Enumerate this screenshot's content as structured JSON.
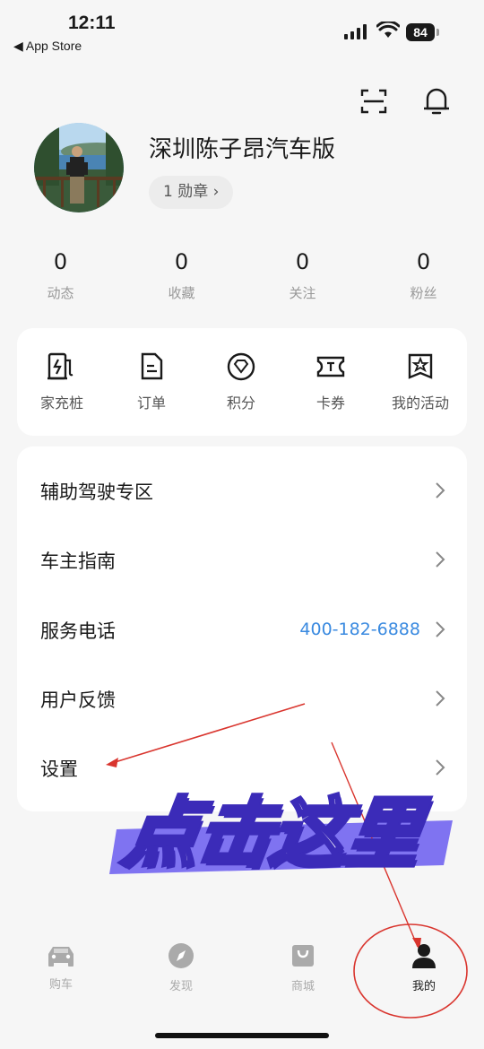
{
  "status_bar": {
    "time": "12:11",
    "back_label": "◀ App Store",
    "battery": "84"
  },
  "header": {
    "scan_icon": "scan-icon",
    "bell_icon": "bell-icon"
  },
  "profile": {
    "name": "深圳陈子昂汽车版",
    "medal": "1 勋章 ›"
  },
  "stats": [
    {
      "value": "0",
      "label": "动态"
    },
    {
      "value": "0",
      "label": "收藏"
    },
    {
      "value": "0",
      "label": "关注"
    },
    {
      "value": "0",
      "label": "粉丝"
    }
  ],
  "services": [
    {
      "label": "家充桩",
      "icon": "charger-icon"
    },
    {
      "label": "订单",
      "icon": "order-icon"
    },
    {
      "label": "积分",
      "icon": "points-icon"
    },
    {
      "label": "卡券",
      "icon": "coupon-icon"
    },
    {
      "label": "我的活动",
      "icon": "activity-icon"
    }
  ],
  "menu": [
    {
      "label": "辅助驾驶专区"
    },
    {
      "label": "车主指南"
    },
    {
      "label": "服务电话",
      "value": "400-182-6888"
    },
    {
      "label": "用户反馈"
    },
    {
      "label": "设置"
    }
  ],
  "tabs": [
    {
      "label": "购车",
      "icon": "car-icon"
    },
    {
      "label": "发现",
      "icon": "compass-icon"
    },
    {
      "label": "商城",
      "icon": "shop-bag-icon"
    },
    {
      "label": "我的",
      "icon": "user-icon",
      "active": true
    }
  ],
  "annotation": {
    "text": "点击这里",
    "color": "#7b5cff",
    "arrow_color": "#d9352e"
  },
  "colors": {
    "link": "#3a8ae0",
    "annotation_red": "#d9352e"
  }
}
